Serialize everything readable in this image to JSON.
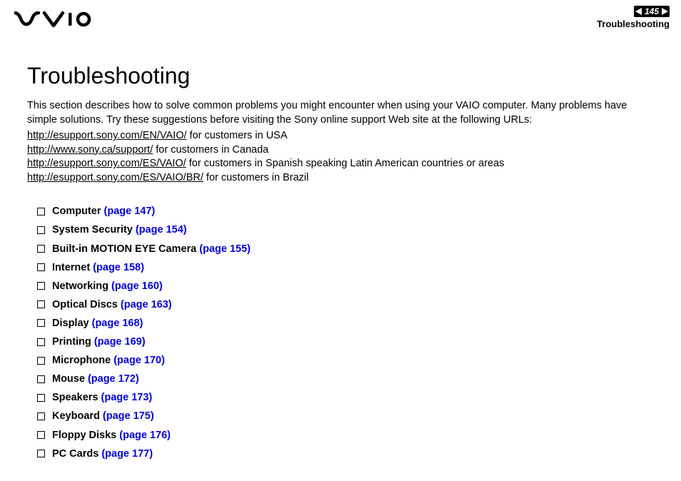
{
  "header": {
    "page_number": "145",
    "section_label": "Troubleshooting"
  },
  "content": {
    "title": "Troubleshooting",
    "intro": "This section describes how to solve common problems you might encounter when using your VAIO computer. Many problems have simple solutions. Try these suggestions before visiting the Sony online support Web site at the following URLs:",
    "urls": [
      {
        "link": "http://esupport.sony.com/EN/VAIO/",
        "suffix": " for customers in USA"
      },
      {
        "link": "http://www.sony.ca/support/",
        "suffix": " for customers in Canada"
      },
      {
        "link": "http://esupport.sony.com/ES/VAIO/",
        "suffix": " for customers in Spanish speaking Latin American countries or areas"
      },
      {
        "link": "http://esupport.sony.com/ES/VAIO/BR/",
        "suffix": " for customers in Brazil"
      }
    ],
    "toc": [
      {
        "label": "Computer",
        "page_ref": "(page 147)"
      },
      {
        "label": "System Security",
        "page_ref": "(page 154)"
      },
      {
        "label": "Built-in MOTION EYE Camera",
        "page_ref": "(page 155)"
      },
      {
        "label": "Internet",
        "page_ref": "(page 158)"
      },
      {
        "label": "Networking",
        "page_ref": "(page 160)"
      },
      {
        "label": "Optical Discs",
        "page_ref": "(page 163)"
      },
      {
        "label": "Display",
        "page_ref": "(page 168)"
      },
      {
        "label": "Printing",
        "page_ref": "(page 169)"
      },
      {
        "label": "Microphone",
        "page_ref": "(page 170)"
      },
      {
        "label": "Mouse",
        "page_ref": "(page 172)"
      },
      {
        "label": "Speakers",
        "page_ref": "(page 173)"
      },
      {
        "label": "Keyboard",
        "page_ref": "(page 175)"
      },
      {
        "label": "Floppy Disks",
        "page_ref": "(page 176)"
      },
      {
        "label": "PC Cards",
        "page_ref": "(page 177)"
      }
    ]
  }
}
